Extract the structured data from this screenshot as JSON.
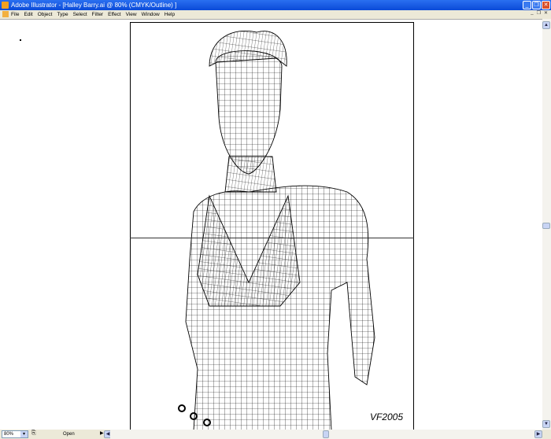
{
  "window": {
    "title": "Adobe Illustrator - [Halley Barry.ai @ 80% (CMYK/Outline) ]"
  },
  "menu": [
    "File",
    "Edit",
    "Object",
    "Type",
    "Select",
    "Filter",
    "Effect",
    "View",
    "Window",
    "Help"
  ],
  "artwork": {
    "signature": "VF2005"
  },
  "status": {
    "zoom": "80%",
    "text": "Open"
  }
}
